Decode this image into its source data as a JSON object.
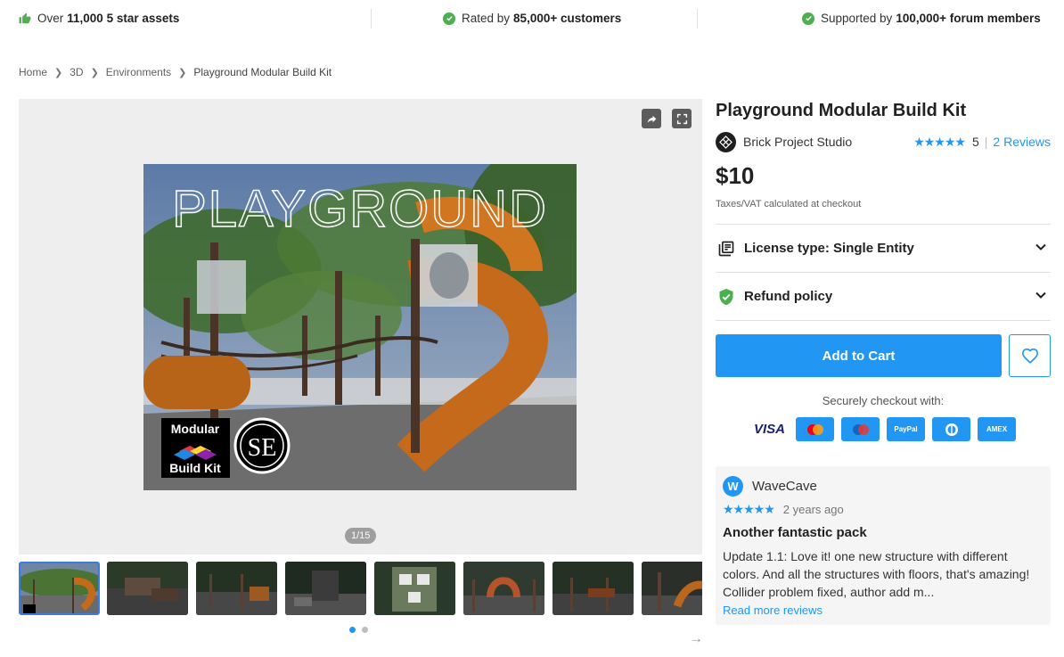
{
  "trust": {
    "item1_prefix": "Over",
    "item1_bold": "11,000 5 star assets",
    "item2_prefix": "Rated by",
    "item2_bold": "85,000+ customers",
    "item3_prefix": "Supported by",
    "item3_bold": "100,000+ forum members"
  },
  "breadcrumb": [
    "Home",
    "3D",
    "Environments",
    "Playground Modular Build Kit"
  ],
  "gallery": {
    "hero_title_text": "PLAYGROUND",
    "badge_line1": "Modular",
    "badge_line2": "Build Kit",
    "badge_logo": "SE",
    "counter": "1/15",
    "thumb_count": 8,
    "active_dot": 0,
    "dot_count": 2
  },
  "product": {
    "title": "Playground Modular Build Kit",
    "publisher": "Brick Project Studio",
    "rating_stars": "★★★★★",
    "rating_value": "5",
    "reviews_link": "2 Reviews",
    "price": "$10",
    "tax_note": "Taxes/VAT calculated at checkout",
    "license_label": "License type: Single Entity",
    "refund_label": "Refund policy",
    "add_to_cart": "Add to Cart",
    "secure_checkout": "Securely checkout with:"
  },
  "payments": [
    {
      "name": "VISA",
      "color": "#ffffff"
    },
    {
      "name": "mastercard",
      "color": "#2196f3"
    },
    {
      "name": "Maestro",
      "color": "#2196f3"
    },
    {
      "name": "PayPal",
      "color": "#2196f3"
    },
    {
      "name": "Diners",
      "color": "#2196f3"
    },
    {
      "name": "AMEX",
      "color": "#2196f3"
    }
  ],
  "review": {
    "avatar_letter": "W",
    "author": "WaveCave",
    "stars": "★★★★★",
    "date": "2 years ago",
    "title": "Another fantastic pack",
    "body": "Update 1.1: Love it! one new structure with different colors. And all the structures with floors, that's amazing! Collider problem fixed, author add m...",
    "read_more": "Read more reviews"
  },
  "colors": {
    "accent": "#2196f3",
    "success": "#4caf50"
  }
}
